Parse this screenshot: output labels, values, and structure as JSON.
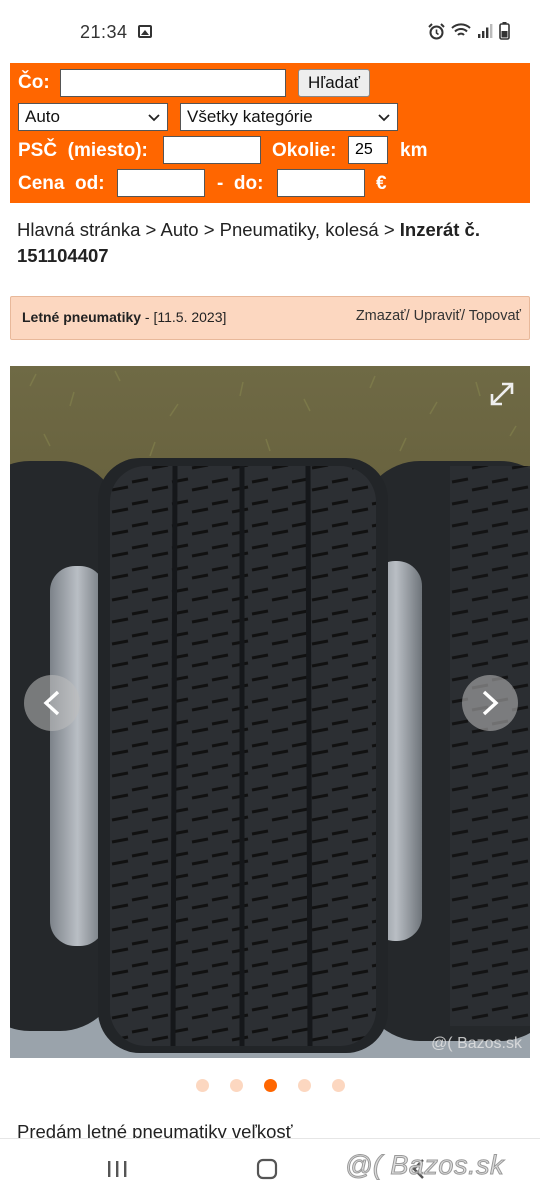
{
  "status": {
    "time": "21:34"
  },
  "search": {
    "what_label": "Čo:",
    "what_value": "",
    "search_button": "Hľadať",
    "section_select": "Auto",
    "category_select": "Všetky kategórie",
    "zip_label": "PSČ  (miesto):",
    "zip_value": "",
    "radius_label": "Okolie:",
    "radius_value": "25",
    "radius_unit": "km",
    "price_label": "Cena  od:",
    "price_from": "",
    "price_sep": "-  do:",
    "price_to": "",
    "currency": "€"
  },
  "breadcrumb": {
    "items": [
      "Hlavná stránka",
      "Auto",
      "Pneumatiky, kolesá"
    ],
    "separator": ">",
    "current": "Inzerát č. 151104407"
  },
  "listing": {
    "title": "Letné pneumatiky",
    "date": "- [11.5. 2023]",
    "actions": [
      "Zmazať",
      "Upraviť",
      "Topovať"
    ],
    "action_sep": "/ "
  },
  "gallery": {
    "image_count": 5,
    "active_index": 2,
    "photo_watermark": "@( Bazos.sk"
  },
  "description_preview": "Predám letné pneumatiky veľkosť",
  "overlay_watermark": "@( Bazos.sk",
  "colors": {
    "brand_orange": "#ff6600",
    "listing_bar": "#fcd7c0"
  },
  "icons": [
    "image-icon",
    "alarm-icon",
    "wifi-icon",
    "signal-icon",
    "battery-icon",
    "chevron-down-icon",
    "expand-icon",
    "chevron-left-icon",
    "chevron-right-icon",
    "recent-apps-icon",
    "home-icon",
    "back-icon"
  ]
}
